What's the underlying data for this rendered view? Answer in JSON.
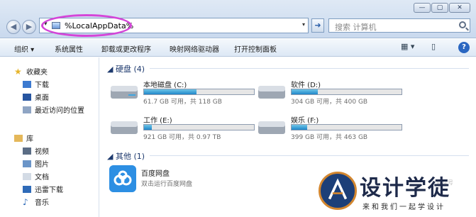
{
  "window": {
    "controls": [
      "—",
      "▢",
      "✕"
    ]
  },
  "address_bar": {
    "path": "%LocalAppData%"
  },
  "search": {
    "placeholder": "搜索 计算机"
  },
  "toolbar": {
    "items": [
      "组织 ▾",
      "系统属性",
      "卸载或更改程序",
      "映射网络驱动器",
      "打开控制面板"
    ]
  },
  "nav": {
    "favorites": "收藏夹",
    "downloads": "下载",
    "desktop": "桌面",
    "recent": "最近访问的位置",
    "libraries": "库",
    "videos": "视频",
    "pictures": "图片",
    "documents": "文档",
    "thunder": "迅雷下载",
    "music": "音乐"
  },
  "content": {
    "hard_disks_header": "硬盘 (4)",
    "other_header": "其他 (1)",
    "drives": [
      {
        "name": "本地磁盘 (C:)",
        "info": "61.7 GB 可用，共 118 GB",
        "used": 0.48
      },
      {
        "name": "软件 (D:)",
        "info": "304 GB 可用，共 400 GB",
        "used": 0.24
      },
      {
        "name": "工作 (E:)",
        "info": "921 GB 可用，共 0.97 TB",
        "used": 0.07
      },
      {
        "name": "娱乐 (F:)",
        "info": "399 GB 可用，共 463 GB",
        "used": 0.14
      }
    ],
    "app": {
      "name": "百度网盘",
      "desc": "双击运行百度网盘"
    }
  },
  "watermark": {
    "title": "设计学徒",
    "subtitle": "来和我们一起学设计",
    "small": "双众号"
  },
  "colors": {
    "highlight": "#d445d8",
    "bar_fill": "#1f86c9",
    "accent": "#2a66c1"
  }
}
